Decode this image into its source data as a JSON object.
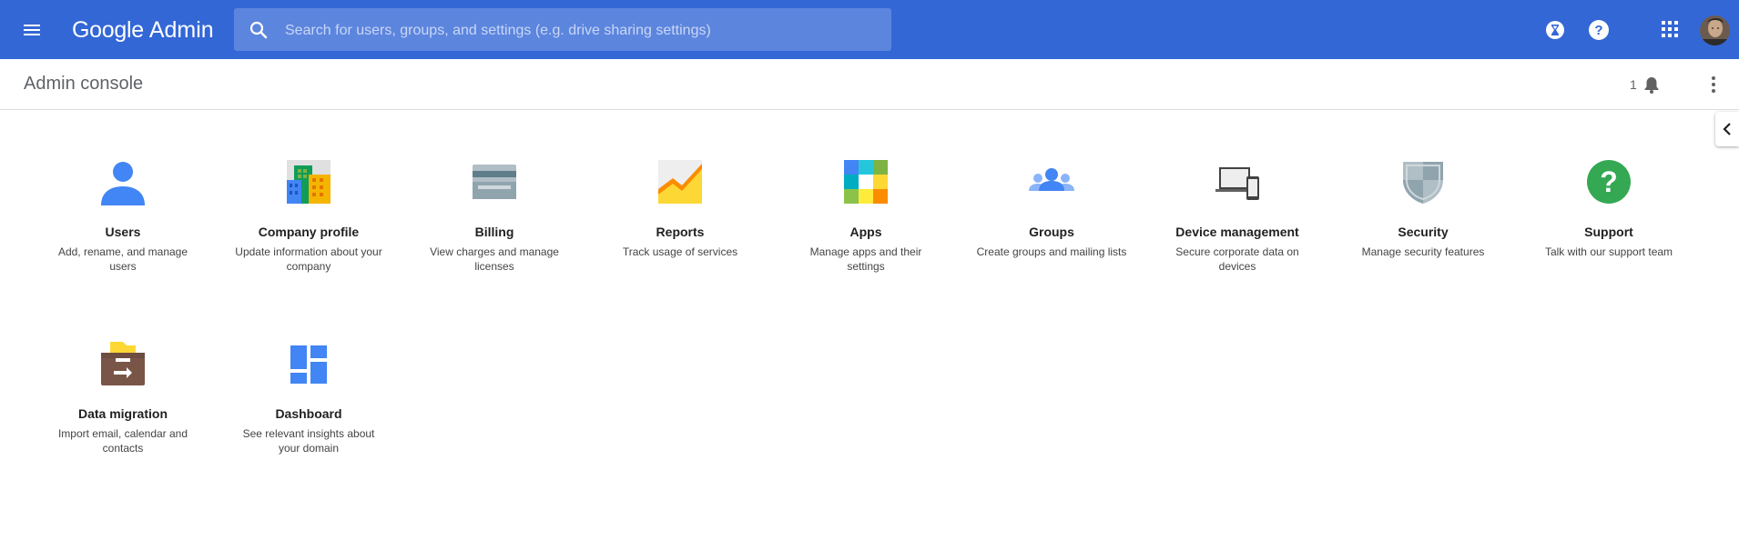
{
  "header": {
    "brand": "Google",
    "product": "Admin",
    "search_placeholder": "Search for users, groups, and settings (e.g. drive sharing settings)",
    "bar_color": "#3367d6"
  },
  "subheader": {
    "title": "Admin console",
    "notification_count": "1"
  },
  "cards": [
    {
      "title": "Users",
      "description": "Add, rename, and manage users",
      "icon": "user-icon"
    },
    {
      "title": "Company profile",
      "description": "Update information about your company",
      "icon": "company-building-icon"
    },
    {
      "title": "Billing",
      "description": "View charges and manage licenses",
      "icon": "credit-card-icon"
    },
    {
      "title": "Reports",
      "description": "Track usage of services",
      "icon": "chart-icon"
    },
    {
      "title": "Apps",
      "description": "Manage apps and their settings",
      "icon": "apps-grid-icon"
    },
    {
      "title": "Groups",
      "description": "Create groups and mailing lists",
      "icon": "group-icon"
    },
    {
      "title": "Device management",
      "description": "Secure corporate data on devices",
      "icon": "devices-icon"
    },
    {
      "title": "Security",
      "description": "Manage security features",
      "icon": "shield-icon"
    },
    {
      "title": "Support",
      "description": "Talk with our support team",
      "icon": "help-circle-icon"
    },
    {
      "title": "Data migration",
      "description": "Import email, calendar and contacts",
      "icon": "migration-box-icon"
    },
    {
      "title": "Dashboard",
      "description": "See relevant insights about your domain",
      "icon": "dashboard-icon"
    }
  ]
}
